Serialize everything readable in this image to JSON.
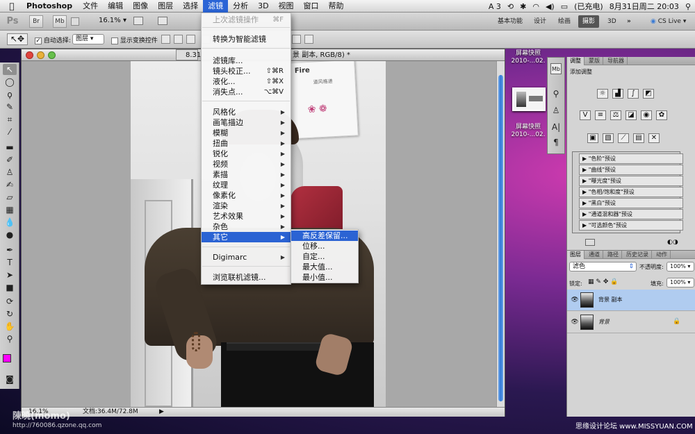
{
  "menubar": {
    "app_name": "Photoshop",
    "items": [
      "文件",
      "编辑",
      "图像",
      "图层",
      "选择",
      "滤镜",
      "分析",
      "3D",
      "视图",
      "窗口",
      "帮助"
    ],
    "active_item": "滤镜",
    "status": {
      "input": "A 3",
      "battery": "(已充电)",
      "datetime": "8月31日周二 20:03"
    }
  },
  "appbar": {
    "logo": "Ps",
    "btn_br": "Br",
    "btn_mb": "Mb",
    "zoom": "16.1%",
    "workspaces": [
      "基本功能",
      "设计",
      "绘画",
      "摄影",
      "3D"
    ],
    "active_workspace": "摄影",
    "more": "»",
    "cslive": "CS Live"
  },
  "optbar": {
    "auto_select_label": "自动选择:",
    "auto_select_value": "图层",
    "show_transform_label": "显示变换控件"
  },
  "document": {
    "title_prefix": "8.31",
    "title_suffix": "景 副本, RGB/8) *",
    "status_zoom": "16.1%",
    "status_doc": "文档:36.4M/72.8M",
    "poster_text": "Fire",
    "poster_sub": "道风格递"
  },
  "filter_menu": {
    "items": [
      {
        "label": "上次滤镜操作",
        "shortcut": "⌘F",
        "disabled": true
      },
      {
        "label": "转换为智能滤镜"
      },
      {
        "label": "滤镜库..."
      },
      {
        "label": "镜头校正...",
        "shortcut": "⇧⌘R"
      },
      {
        "label": "液化...",
        "shortcut": "⇧⌘X"
      },
      {
        "label": "消失点...",
        "shortcut": "⌥⌘V"
      },
      {
        "label": "风格化",
        "arrow": "▶"
      },
      {
        "label": "画笔描边",
        "arrow": "▶"
      },
      {
        "label": "模糊",
        "arrow": "▶"
      },
      {
        "label": "扭曲",
        "arrow": "▶"
      },
      {
        "label": "锐化",
        "arrow": "▶"
      },
      {
        "label": "视频",
        "arrow": "▶"
      },
      {
        "label": "素描",
        "arrow": "▶"
      },
      {
        "label": "纹理",
        "arrow": "▶"
      },
      {
        "label": "像素化",
        "arrow": "▶"
      },
      {
        "label": "渲染",
        "arrow": "▶"
      },
      {
        "label": "艺术效果",
        "arrow": "▶"
      },
      {
        "label": "杂色",
        "arrow": "▶"
      },
      {
        "label": "其它",
        "arrow": "▶"
      },
      {
        "label": "Digimarc",
        "arrow": "▶"
      },
      {
        "label": "浏览联机滤镜..."
      }
    ],
    "highlighted": "其它"
  },
  "submenu": {
    "items": [
      "高反差保留...",
      "位移...",
      "自定...",
      "最大值...",
      "最小值..."
    ],
    "highlighted": "高反差保留..."
  },
  "desktop": {
    "snap1_line1": "屏幕快照",
    "snap1_line2": "2010-...02.",
    "snap2_line1": "屏幕快照",
    "snap2_line2": "2010-...02.",
    "watermark_left": "陳曉(momo)",
    "watermark_url": "http://760086.qzone.qq.com",
    "watermark_right": "思缘设计论坛 www.MISSYUAN.COM"
  },
  "adjustments": {
    "tabs": [
      "调整",
      "蒙版",
      "导航器"
    ],
    "active_tab": "调整",
    "header": "添加调整",
    "presets": [
      "\"色阶\"预设",
      "\"曲线\"预设",
      "\"曝光度\"预设",
      "\"色相/饱和度\"预设",
      "\"黑白\"预设",
      "\"通道混和器\"预设",
      "\"可选颜色\"预设"
    ],
    "preset_arrow": "▶"
  },
  "layers": {
    "tabs": [
      "图层",
      "通道",
      "路径",
      "历史记录",
      "动作"
    ],
    "active_tab": "图层",
    "blend_mode": "滤色",
    "opacity_label": "不透明度:",
    "opacity_value": "100%",
    "lock_label": "锁定:",
    "fill_label": "填充:",
    "fill_value": "100%",
    "items": [
      {
        "name": "背景 副本",
        "selected": true
      },
      {
        "name": "背景",
        "selected": false,
        "locked": true
      }
    ]
  },
  "colors": {
    "menu_highlight": "#2b63d3",
    "foreground": "#ff00ff",
    "background": "#000000"
  }
}
